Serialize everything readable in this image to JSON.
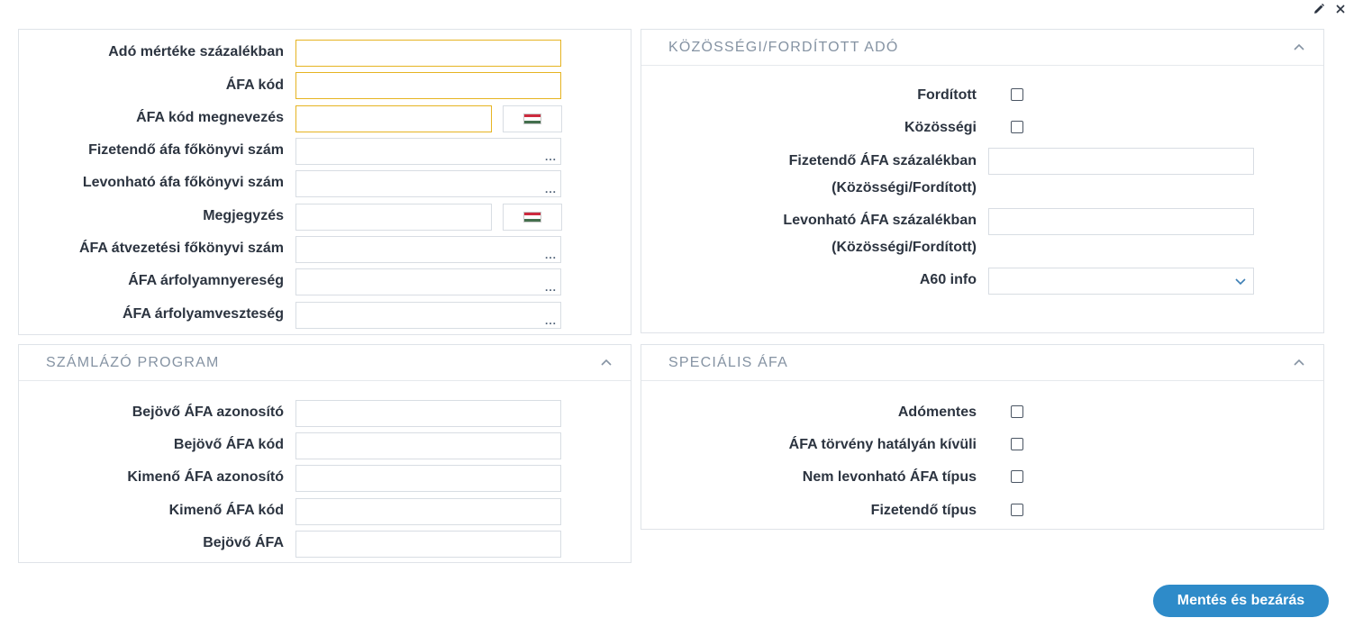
{
  "toolbar": {
    "edit_icon": "pencil-icon",
    "close_icon": "close-icon"
  },
  "general": {
    "fields": [
      {
        "label": "Adó mértéke százalékban",
        "value": "",
        "required": true
      },
      {
        "label": "ÁFA kód",
        "value": "",
        "required": true
      },
      {
        "label": "ÁFA kód megnevezés",
        "value": "",
        "required": true,
        "language": "hungarian-flag-icon"
      },
      {
        "label": "Fizetendő áfa főkönyvi szám",
        "value": "",
        "lookup": "..."
      },
      {
        "label": "Levonható áfa főkönyvi szám",
        "value": "",
        "lookup": "..."
      },
      {
        "label": "Megjegyzés",
        "value": "",
        "language": "hungarian-flag-icon"
      },
      {
        "label": "ÁFA átvezetési főkönyvi szám",
        "value": "",
        "lookup": "..."
      },
      {
        "label": "ÁFA árfolyamnyereség",
        "value": "",
        "lookup": "..."
      },
      {
        "label": "ÁFA árfolyamveszteség",
        "value": "",
        "lookup": "..."
      }
    ]
  },
  "community": {
    "title": "KÖZÖSSÉGI/FORDÍTOTT ADÓ",
    "reverse_label": "Fordított",
    "community_label": "Közösségi",
    "payable_label": "Fizetendő ÁFA százalékban (Közösségi/Fordított)",
    "payable_value": "",
    "deductible_label": "Levonható ÁFA százalékban (Közösségi/Fordított)",
    "deductible_value": "",
    "a60_label": "A60 info",
    "a60_value": ""
  },
  "billing": {
    "title": "SZÁMLÁZÓ PROGRAM",
    "fields": [
      {
        "label": "Bejövő ÁFA azonosító",
        "value": ""
      },
      {
        "label": "Bejövő ÁFA kód",
        "value": ""
      },
      {
        "label": "Kimenő ÁFA azonosító",
        "value": ""
      },
      {
        "label": "Kimenő ÁFA kód",
        "value": ""
      },
      {
        "label": "Bejövő ÁFA",
        "value": ""
      }
    ]
  },
  "special": {
    "title": "SPECIÁLIS ÁFA",
    "items": [
      {
        "label": "Adómentes",
        "checked": false
      },
      {
        "label": "ÁFA törvény hatályán kívüli",
        "checked": false
      },
      {
        "label": "Nem levonható ÁFA típus",
        "checked": false
      },
      {
        "label": "Fizetendő típus",
        "checked": false
      }
    ]
  },
  "actions": {
    "save_label": "Mentés és bezárás"
  },
  "colors": {
    "accent": "#2e8bc9",
    "required_border": "#e6b422",
    "panel_title": "#8593a3"
  }
}
